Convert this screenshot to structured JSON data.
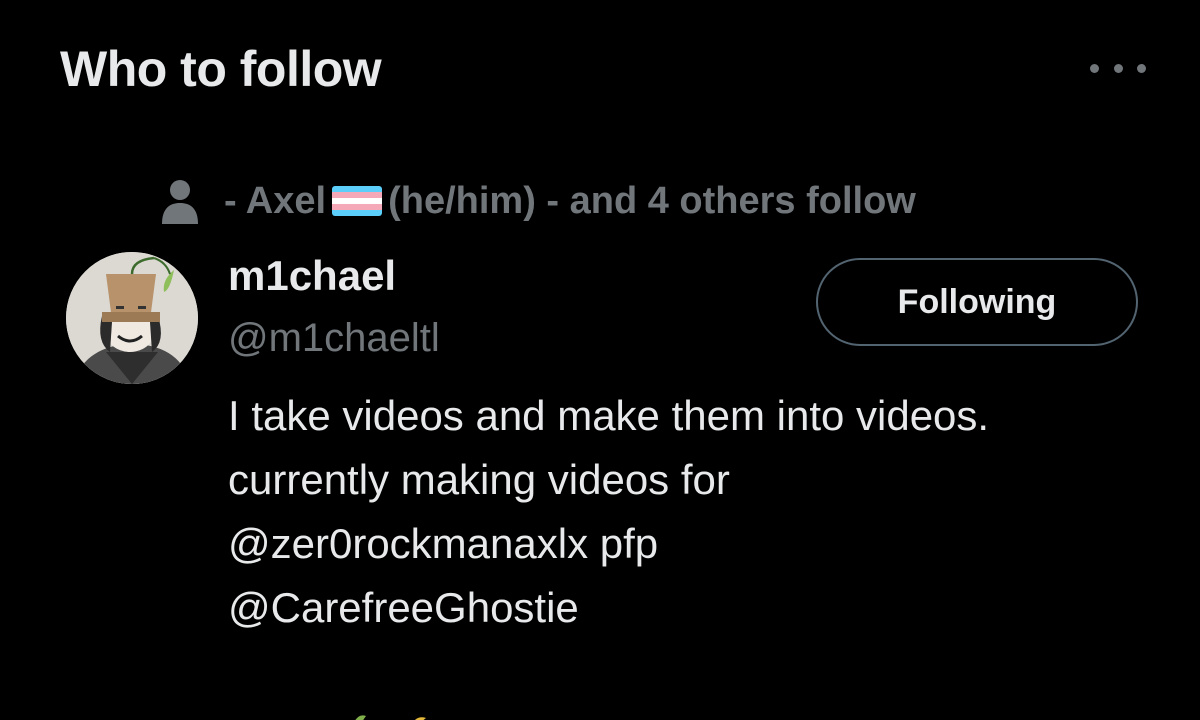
{
  "section": {
    "title": "Who to follow",
    "more_icon": "more-horizontal-icon"
  },
  "social_context": {
    "icon": "person-icon",
    "prefix": "- Axel",
    "flag": "transgender-flag-emoji",
    "suffix": "(he/him) - and 4 others follow"
  },
  "account": {
    "display_name": "m1chael",
    "handle": "@m1chaeltl",
    "follow_button_label": "Following",
    "bio": {
      "line1": "I take videos and make them into videos.",
      "line2": "currently making videos for",
      "mention1": "@zer0rockmanaxlx",
      "pfp_text": "pfp",
      "mention2": "@CarefreeGhostie"
    }
  },
  "colors": {
    "background": "#000000",
    "primary_text": "#e7e9ea",
    "secondary_text": "#71767b",
    "button_border": "#536471",
    "flag_blue": "#5bcefa",
    "flag_pink": "#f5a9b8",
    "flag_white": "#ffffff"
  }
}
